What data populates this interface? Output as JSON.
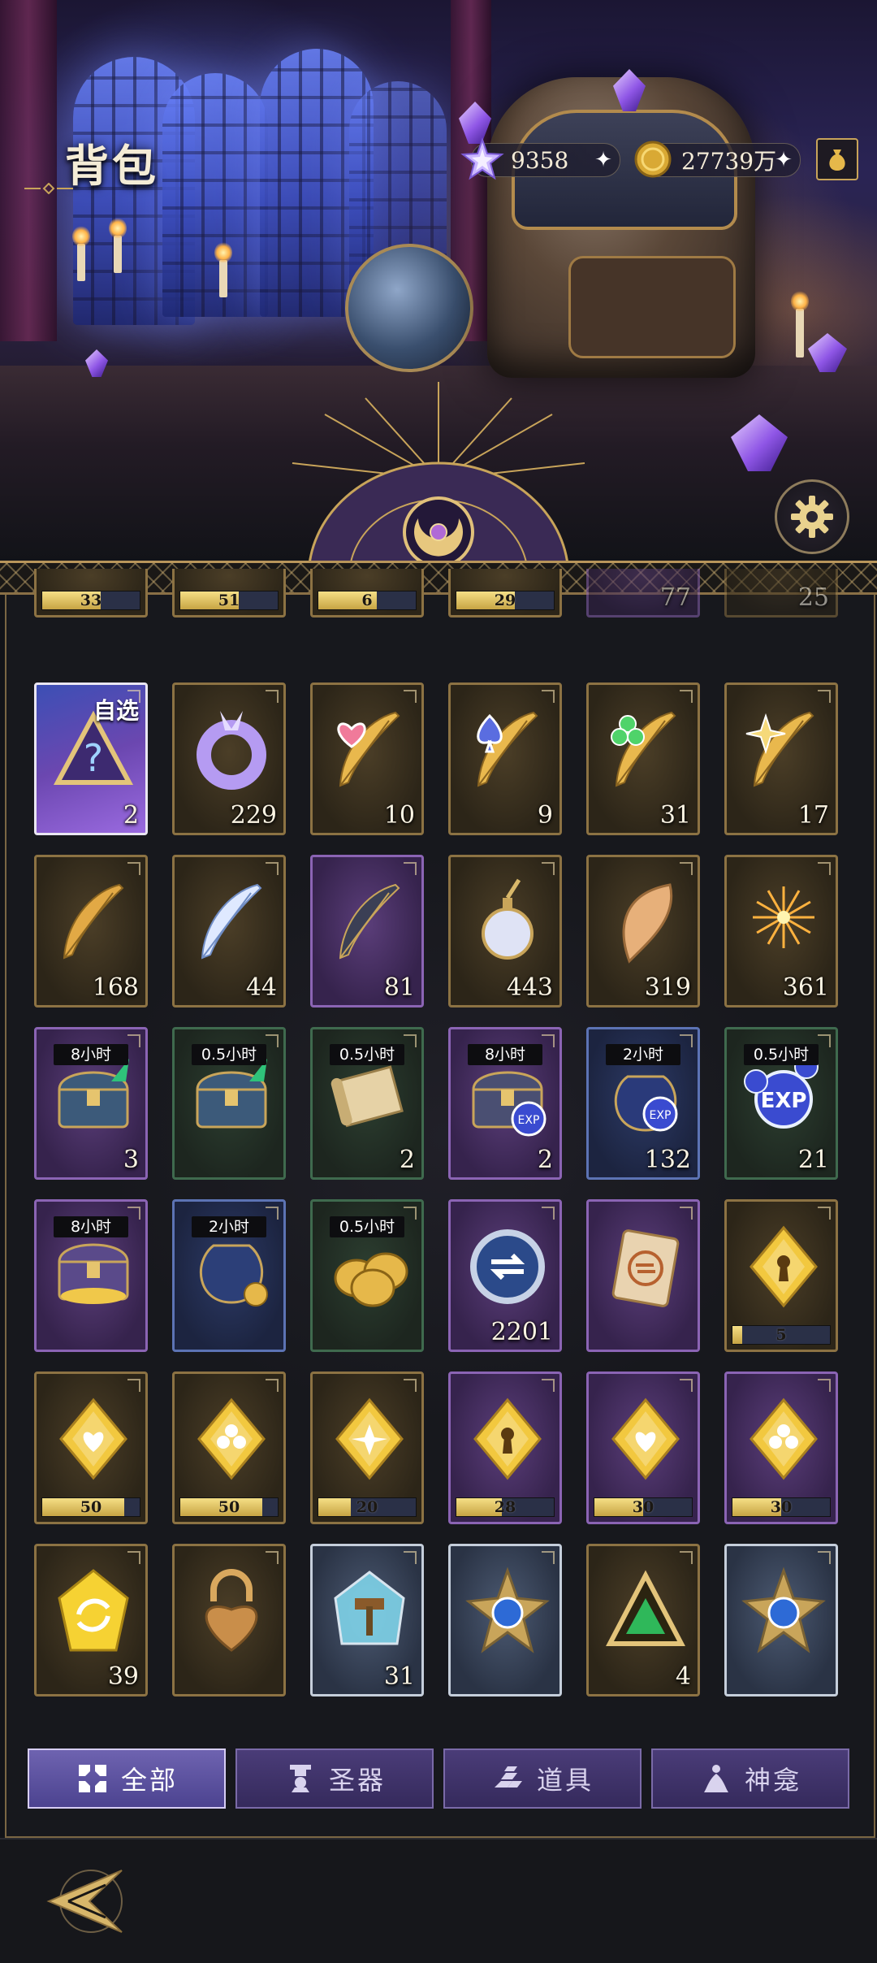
{
  "header": {
    "title": "背包",
    "resources": [
      {
        "icon": "star-crystal-icon",
        "value": "9358"
      },
      {
        "icon": "gold-coin-icon",
        "value": "27739万"
      }
    ]
  },
  "grid": {
    "partial_row": [
      {
        "count": "33",
        "frame": "gold",
        "bar": true
      },
      {
        "count": "51",
        "frame": "gold",
        "bar": true
      },
      {
        "count": "6",
        "frame": "gold",
        "bar": true
      },
      {
        "count": "29",
        "frame": "gold",
        "bar": true
      },
      {
        "count": "77",
        "frame": "purple",
        "bar": false
      },
      {
        "count": "25",
        "frame": "gold",
        "bar": false
      }
    ],
    "rows": [
      [
        {
          "name": "self-select-chest",
          "frame": "selfsel",
          "tag": "自选",
          "count": "2",
          "icon": "question-triangle-icon"
        },
        {
          "name": "crystal-ring",
          "frame": "gold",
          "count": "229",
          "icon": "crystal-ring-icon"
        },
        {
          "name": "heart-feather",
          "frame": "gold",
          "count": "10",
          "icon": "heart-feather-icon"
        },
        {
          "name": "spade-feather",
          "frame": "gold",
          "count": "9",
          "icon": "spade-feather-icon"
        },
        {
          "name": "club-feather",
          "frame": "gold",
          "count": "31",
          "icon": "club-feather-icon"
        },
        {
          "name": "star-feather",
          "frame": "gold",
          "count": "17",
          "icon": "star-feather-icon"
        }
      ],
      [
        {
          "name": "golden-feather",
          "frame": "gold",
          "count": "168",
          "icon": "golden-feather-icon"
        },
        {
          "name": "white-feather",
          "frame": "gold",
          "count": "44",
          "icon": "white-feather-icon"
        },
        {
          "name": "dark-feather",
          "frame": "purple",
          "count": "81",
          "icon": "dark-feather-icon"
        },
        {
          "name": "perfume-bottle",
          "frame": "gold",
          "count": "443",
          "icon": "perfume-bottle-icon"
        },
        {
          "name": "conch-shell",
          "frame": "gold",
          "count": "319",
          "icon": "conch-shell-icon"
        },
        {
          "name": "fireworks",
          "frame": "gold",
          "count": "361",
          "icon": "fireworks-icon"
        }
      ],
      [
        {
          "name": "chest-8h",
          "frame": "purple",
          "timer": "8小时",
          "count": "3",
          "icon": "treasure-chest-icon"
        },
        {
          "name": "chest-05h",
          "frame": "green",
          "timer": "0.5小时",
          "count": "",
          "icon": "treasure-chest-icon"
        },
        {
          "name": "scroll-05h",
          "frame": "green",
          "timer": "0.5小时",
          "count": "2",
          "icon": "scroll-icon"
        },
        {
          "name": "exp-chest-8h",
          "frame": "purple",
          "timer": "8小时",
          "count": "2",
          "icon": "exp-chest-icon"
        },
        {
          "name": "exp-bag-2h",
          "frame": "blue",
          "timer": "2小时",
          "count": "132",
          "icon": "exp-bag-icon"
        },
        {
          "name": "exp-orb-05h",
          "frame": "green",
          "timer": "0.5小时",
          "count": "21",
          "icon": "exp-orb-icon"
        }
      ],
      [
        {
          "name": "gold-chest-8h",
          "frame": "purple",
          "timer": "8小时",
          "count": "",
          "icon": "gold-chest-icon"
        },
        {
          "name": "coin-bag-2h",
          "frame": "blue",
          "timer": "2小时",
          "count": "",
          "icon": "coin-bag-icon"
        },
        {
          "name": "coin-stack-05h",
          "frame": "green",
          "timer": "0.5小时",
          "count": "",
          "icon": "coin-stack-icon"
        },
        {
          "name": "swap-token",
          "frame": "purple",
          "count": "2201",
          "icon": "swap-token-icon"
        },
        {
          "name": "swap-ticket",
          "frame": "purple",
          "count": "",
          "icon": "swap-ticket-icon"
        },
        {
          "name": "gold-keyhole-gem",
          "frame": "gold",
          "count": "",
          "icon": "keyhole-gem-icon",
          "bar": {
            "text": "5",
            "fill": 0.1
          }
        }
      ],
      [
        {
          "name": "gold-heart-gem",
          "frame": "gold",
          "icon": "heart-gem-icon",
          "bar": {
            "text": "50",
            "fill": 0.84
          }
        },
        {
          "name": "gold-club-gem",
          "frame": "gold",
          "icon": "club-gem-icon",
          "bar": {
            "text": "50",
            "fill": 0.84
          }
        },
        {
          "name": "gold-star-gem",
          "frame": "gold",
          "icon": "star-gem-icon",
          "bar": {
            "text": "20",
            "fill": 0.33
          }
        },
        {
          "name": "purple-keyhole-gem",
          "frame": "purple",
          "icon": "keyhole-gem-icon",
          "bar": {
            "text": "28",
            "fill": 0.47
          }
        },
        {
          "name": "purple-heart-gem",
          "frame": "purple",
          "icon": "heart-gem-icon",
          "bar": {
            "text": "30",
            "fill": 0.5
          }
        },
        {
          "name": "purple-club-gem",
          "frame": "purple",
          "icon": "club-gem-icon",
          "bar": {
            "text": "30",
            "fill": 0.5
          }
        }
      ],
      [
        {
          "name": "refresh-gem",
          "frame": "gold",
          "count": "39",
          "icon": "refresh-gem-icon"
        },
        {
          "name": "heart-padlock",
          "frame": "gold",
          "count": "",
          "icon": "padlock-icon"
        },
        {
          "name": "hammer-crystal",
          "frame": "silver",
          "count": "31",
          "icon": "hammer-crystal-icon"
        },
        {
          "name": "blue-star-emblem",
          "frame": "silver",
          "count": "",
          "icon": "star-emblem-icon"
        },
        {
          "name": "green-triangle-gem",
          "frame": "gold",
          "count": "4",
          "icon": "triangle-gem-icon"
        },
        {
          "name": "red-star-emblem",
          "frame": "silver",
          "count": "",
          "icon": "star-emblem-icon"
        }
      ]
    ]
  },
  "tabs": [
    {
      "label": "全部",
      "icon": "all-grid-icon",
      "active": true
    },
    {
      "label": "圣器",
      "icon": "relic-icon",
      "active": false
    },
    {
      "label": "道具",
      "icon": "gold-bars-icon",
      "active": false
    },
    {
      "label": "神龛",
      "icon": "shrine-icon",
      "active": false
    }
  ],
  "colors": {
    "accent_gold": "#c8a45a",
    "tab_active": "#6e63b0",
    "tab_inactive": "#4a3c78",
    "background": "#121318"
  }
}
